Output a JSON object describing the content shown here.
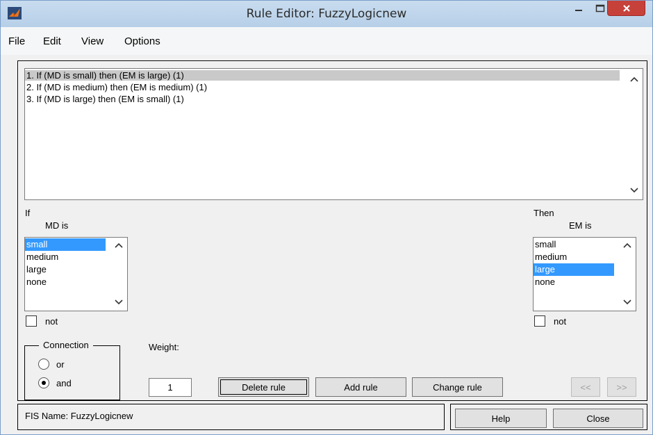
{
  "window": {
    "title": "Rule Editor: FuzzyLogicnew"
  },
  "menu": {
    "file": "File",
    "edit": "Edit",
    "view": "View",
    "options": "Options"
  },
  "rules": [
    "1. If (MD is small) then (EM is large) (1)",
    "2. If (MD is medium) then (EM is medium) (1)",
    "3. If (MD is large) then (EM is small) (1)"
  ],
  "input": {
    "if_label": "If",
    "var_label": "MD is",
    "items": [
      "small",
      "medium",
      "large",
      "none"
    ],
    "selected": "small",
    "not_label": "not"
  },
  "output": {
    "then_label": "Then",
    "var_label": "EM is",
    "items": [
      "small",
      "medium",
      "large",
      "none"
    ],
    "selected": "large",
    "not_label": "not"
  },
  "connection": {
    "title": "Connection",
    "or_label": "or",
    "and_label": "and",
    "selected": "and"
  },
  "weight": {
    "label": "Weight:",
    "value": "1"
  },
  "buttons": {
    "delete_rule": "Delete rule",
    "add_rule": "Add rule",
    "change_rule": "Change rule",
    "prev": "<<",
    "next": ">>",
    "help": "Help",
    "close": "Close"
  },
  "status": {
    "text": "FIS Name: FuzzyLogicnew"
  },
  "colors": {
    "selection": "#3399ff",
    "close_button": "#c7413b",
    "titlebar": "#c9dcef"
  }
}
